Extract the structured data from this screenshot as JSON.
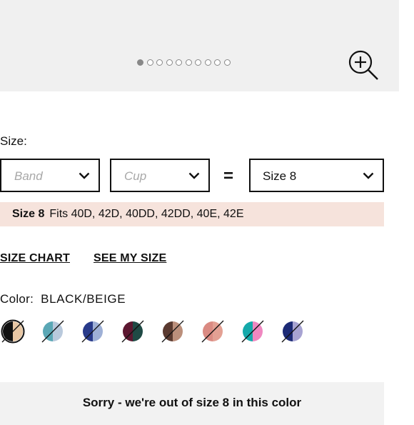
{
  "gallery": {
    "image_count": 10,
    "active_index": 0,
    "zoom_icon": "zoom-in-icon"
  },
  "size": {
    "label": "Size:",
    "band_placeholder": "Band",
    "cup_placeholder": "Cup",
    "equals": "=",
    "selected_size": "Size 8",
    "chevron_icon": "chevron-down-icon"
  },
  "fit": {
    "size": "Size 8",
    "text": "Fits 40D, 42D, 40DD, 42DD, 40E, 42E"
  },
  "links": {
    "size_chart": "SIZE CHART",
    "see_my_size": "SEE MY SIZE"
  },
  "color": {
    "label": "Color:",
    "value": "BLACK/BEIGE",
    "swatches": [
      {
        "name": "swatch-black-beige",
        "colors": [
          "#111111",
          "#e8c7a4"
        ],
        "selected": true,
        "unavailable": true
      },
      {
        "name": "swatch-light-blue-print",
        "colors": [
          "#5aa7b5",
          "#b9c9dc"
        ],
        "selected": false,
        "unavailable": true
      },
      {
        "name": "swatch-navy-print",
        "colors": [
          "#283a8a",
          "#9eb0d6"
        ],
        "selected": false,
        "unavailable": true
      },
      {
        "name": "swatch-burgundy-green",
        "colors": [
          "#5c1730",
          "#1f4a45"
        ],
        "selected": false,
        "unavailable": true
      },
      {
        "name": "swatch-leopard",
        "colors": [
          "#5a3a30",
          "#bb8f7b"
        ],
        "selected": false,
        "unavailable": true
      },
      {
        "name": "swatch-coral",
        "colors": [
          "#da8a82",
          "#e3a093"
        ],
        "selected": false,
        "unavailable": true
      },
      {
        "name": "swatch-teal-pink",
        "colors": [
          "#14a9aa",
          "#ef87c0"
        ],
        "selected": false,
        "unavailable": true
      },
      {
        "name": "swatch-navy-lavender",
        "colors": [
          "#1c2a76",
          "#a7a3d2"
        ],
        "selected": false,
        "unavailable": true
      }
    ]
  },
  "notice": {
    "text": "Sorry - we're out of size 8 in this color"
  }
}
